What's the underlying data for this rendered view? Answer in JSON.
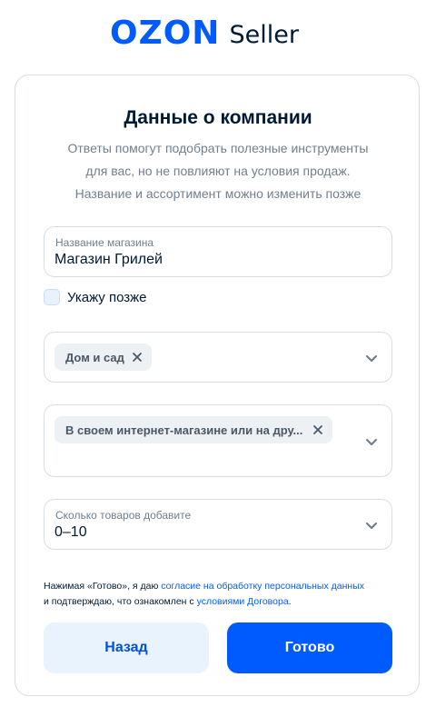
{
  "header": {
    "logo_brand": "OZON",
    "logo_product": "Seller"
  },
  "form": {
    "title": "Данные о компании",
    "subtitle_lines": [
      "Ответы помогут подобрать полезные инструменты",
      "для вас, но не повлияют на условия продаж.",
      "Название и ассортимент можно изменить позже"
    ],
    "store_name": {
      "label": "Название магазина",
      "value": "Магазин Грилей"
    },
    "later_checkbox": {
      "label": "Укажу позже",
      "checked": false
    },
    "category_select": {
      "chips": [
        "Дом и сад"
      ],
      "icon": "chevron-down-icon"
    },
    "sales_channel_select": {
      "chips": [
        "В своем интернет-магазине или на дру..."
      ],
      "icon": "chevron-down-icon"
    },
    "products_count_select": {
      "label": "Сколько товаров добавите",
      "value": "0–10",
      "icon": "chevron-down-icon"
    },
    "consent": {
      "prefix": "Нажимая «Готово», я даю ",
      "link1": "согласие на обработку персональных данных",
      "middle": " и подтверждаю, что ознакомлен с ",
      "link2": "условиями Договора",
      "suffix": "."
    },
    "buttons": {
      "back": "Назад",
      "done": "Готово"
    }
  },
  "colors": {
    "brand": "#005bff",
    "text": "#001a34",
    "muted": "#707f8d",
    "border": "#d8dde4",
    "secondary_button_bg": "#e9f3fd"
  }
}
